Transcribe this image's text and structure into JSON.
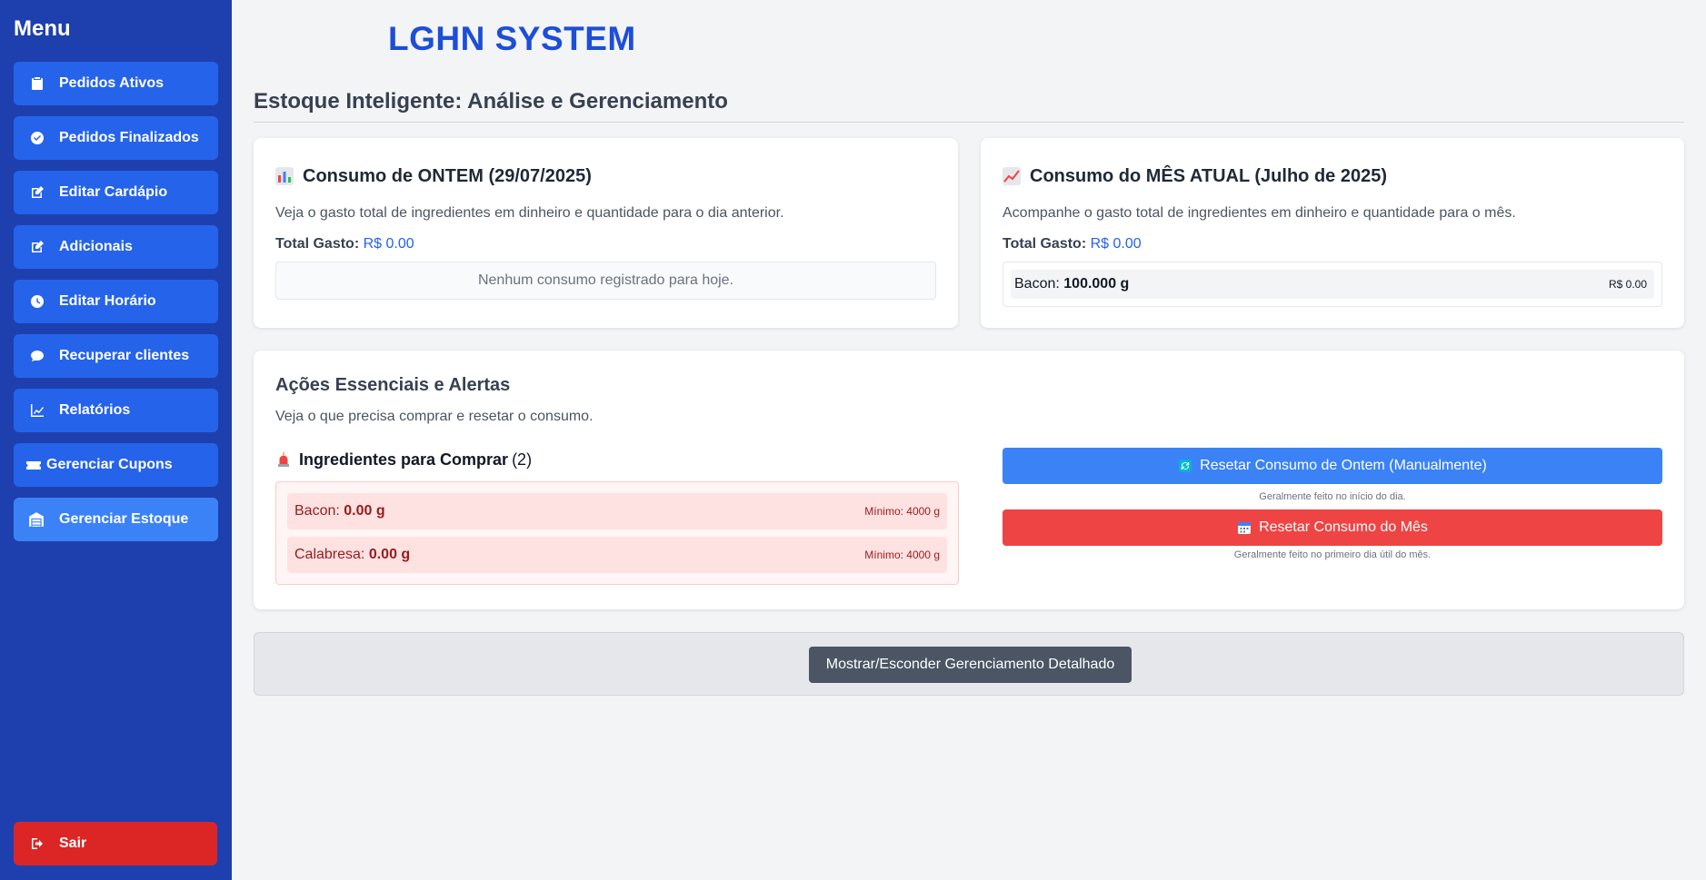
{
  "sidebar": {
    "title": "Menu",
    "items": [
      {
        "label": "Pedidos Ativos",
        "icon": "clipboard-icon"
      },
      {
        "label": "Pedidos Finalizados",
        "icon": "check-circle-icon"
      },
      {
        "label": "Editar Cardápio",
        "icon": "edit-icon"
      },
      {
        "label": "Adicionais",
        "icon": "edit-icon"
      },
      {
        "label": "Editar Horário",
        "icon": "clock-icon"
      },
      {
        "label": "Recuperar clientes",
        "icon": "chat-bubble-icon"
      },
      {
        "label": "Relatórios",
        "icon": "line-chart-icon"
      },
      {
        "label": "Gerenciar Cupons",
        "icon": "ticket-icon"
      },
      {
        "label": "Gerenciar Estoque",
        "icon": "warehouse-icon",
        "active": true
      }
    ],
    "logout_label": "Sair"
  },
  "header": {
    "brand": "LGHN SYSTEM",
    "page_title": "Estoque Inteligente: Análise e Gerenciamento"
  },
  "yesterday": {
    "title": "Consumo de ONTEM (29/07/2025)",
    "icon": "bar-chart-emoji-icon",
    "description": "Veja o gasto total de ingredientes em dinheiro e quantidade para o dia anterior.",
    "total_label": "Total Gasto:",
    "total_value": "R$ 0.00",
    "empty_message": "Nenhum consumo registrado para hoje."
  },
  "month": {
    "title": "Consumo do MÊS ATUAL (Julho de 2025)",
    "icon": "trend-up-emoji-icon",
    "description": "Acompanhe o gasto total de ingredientes em dinheiro e quantidade para o mês.",
    "total_label": "Total Gasto:",
    "total_value": "R$ 0.00",
    "items": [
      {
        "name": "Bacon:",
        "qty": "100.000 g",
        "cost": "R$ 0.00"
      }
    ]
  },
  "actions": {
    "title": "Ações Essenciais e Alertas",
    "description": "Veja o que precisa comprar e resetar o consumo.",
    "buy_title": "Ingredientes para Comprar",
    "buy_count": "(2)",
    "buy_items": [
      {
        "name": "Bacon:",
        "qty": "0.00 g",
        "min": "Mínimo: 4000 g"
      },
      {
        "name": "Calabresa:",
        "qty": "0.00 g",
        "min": "Mínimo: 4000 g"
      }
    ],
    "reset_day_label": "Resetar Consumo de Ontem (Manualmente)",
    "reset_day_hint": "Geralmente feito no início do dia.",
    "reset_month_label": "Resetar Consumo do Mês",
    "reset_month_hint": "Geralmente feito no primeiro dia útil do mês."
  },
  "toggle_label": "Mostrar/Esconder Gerenciamento Detalhado",
  "colors": {
    "sidebar_bg": "#1e40af",
    "nav_button": "#2563eb",
    "accent_blue": "#3b82f6",
    "danger_red": "#ef4444",
    "logout_red": "#dc2626",
    "brand_blue": "#1d4ed8"
  }
}
